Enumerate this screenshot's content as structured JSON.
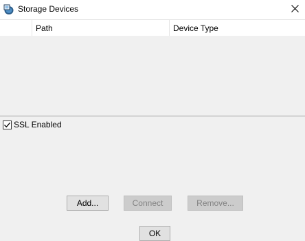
{
  "window": {
    "title": "Storage Devices",
    "icon": "storage-device-icon",
    "close_icon": "close-icon"
  },
  "table": {
    "columns": [
      "",
      "Path",
      "Device Type"
    ],
    "rows": []
  },
  "ssl": {
    "label": "SSL Enabled",
    "checked": true
  },
  "buttons": {
    "add": "Add...",
    "connect": "Connect",
    "remove": "Remove...",
    "ok": "OK"
  },
  "colors": {
    "dialog_bg": "#f0f0f0",
    "titlebar_bg": "#ffffff",
    "button_bg": "#e1e1e1",
    "button_disabled_bg": "#cccccc",
    "disabled_text": "#838383"
  }
}
